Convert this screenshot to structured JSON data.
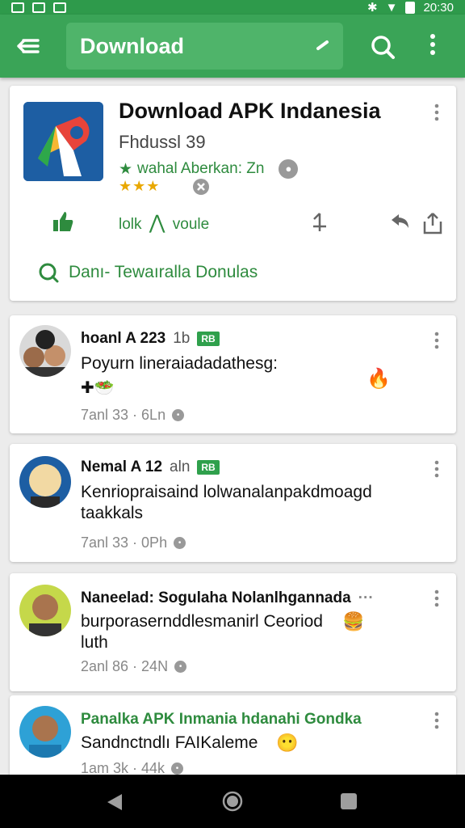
{
  "status_bar": {
    "time": "20:30"
  },
  "app_bar": {
    "title": "Download"
  },
  "app_card": {
    "title": "Download APK Indanesia",
    "subtitle": "Fhdussl 39",
    "rating_text": "wahal Aberkan: Zn",
    "stars": "★★★",
    "actions_text": "lolk",
    "actions_label": "voule",
    "download_text": "Danı- Tewaıralla Donulas"
  },
  "posts": [
    {
      "name": "hoanl A 223",
      "meta": "1b",
      "badge": "RB",
      "body": "Poyurn lineraiadadathesg:",
      "time": "7anl 33 · 6Ln"
    },
    {
      "name": "Nemal A 12",
      "meta": "aln",
      "badge": "RB",
      "body": "Kenriopraisaind lolwanalanpakdmoagd taakkals",
      "time": "7anl 33 · 0Ph"
    },
    {
      "name": "Naneelad: Sogulaha Nolanlhgannada",
      "meta": "",
      "badge": "",
      "body": "burporasernddlesmanirl Ceoriod luth",
      "time": "2anl 86 · 24N"
    },
    {
      "name": "Panalka APK Inmania hdanahi Gondka",
      "meta": "",
      "badge": "",
      "body": "Sandnctndlı FAIKaleme",
      "time": "1am 3k · 44k"
    }
  ],
  "icons": {
    "menu": "menu-icon",
    "edit": "edit-icon",
    "search": "search-icon",
    "more": "more-vert-icon",
    "like": "thumbs-up-icon",
    "share": "share-icon",
    "back": "back-nav-icon",
    "home": "home-nav-icon",
    "recents": "recents-nav-icon"
  },
  "colors": {
    "primary": "#3aa457",
    "accent": "#2e8b3e",
    "star": "#e9a800"
  }
}
